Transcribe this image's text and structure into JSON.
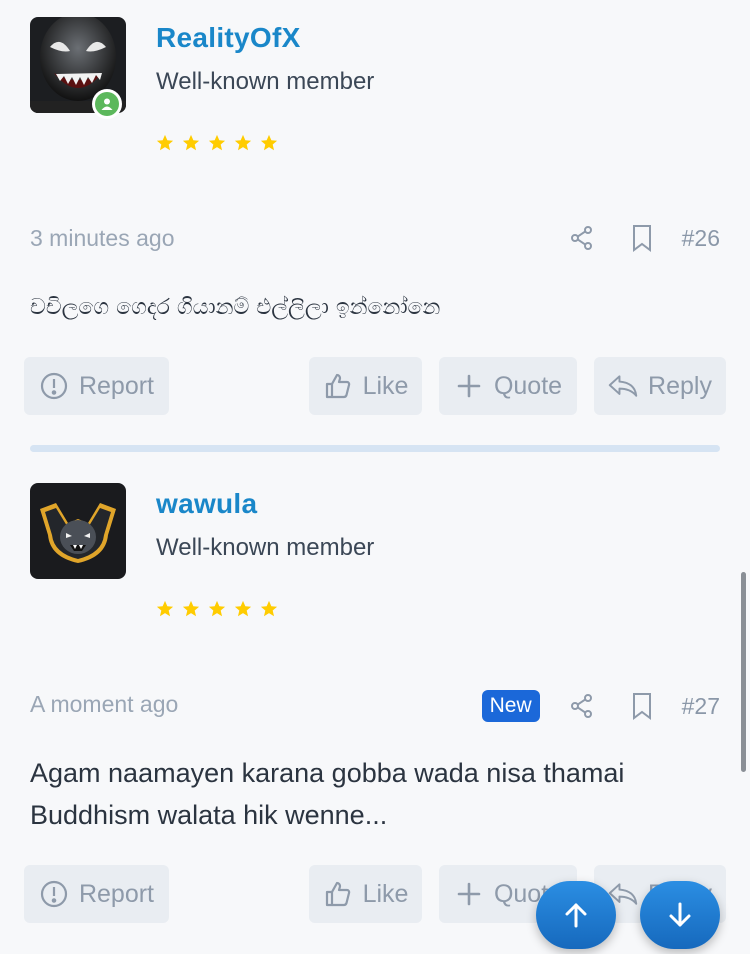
{
  "posts": [
    {
      "username": "RealityOfX",
      "user_title": "Well-known member",
      "stars": 5,
      "time": "3 minutes ago",
      "is_new": false,
      "number": "#26",
      "body": "චචිලගෙ ගෙදර ගියානම් එල්ලිලා ඉන්නෝනෙ",
      "actions": {
        "report": "Report",
        "like": "Like",
        "quote": "Quote",
        "reply": "Reply"
      }
    },
    {
      "username": "wawula",
      "user_title": "Well-known member",
      "stars": 5,
      "time": "A moment ago",
      "is_new": true,
      "new_label": "New",
      "number": "#27",
      "body": "Agam naamayen karana gobba wada nisa thamai Buddhism walata hik wenne...",
      "actions": {
        "report": "Report",
        "like": "Like",
        "quote": "Quote",
        "reply": "Reply"
      }
    }
  ],
  "colors": {
    "accent": "#1a87c9",
    "star": "#ffcc00",
    "new_badge": "#1b68d9",
    "online": "#5cb85c"
  },
  "icons": [
    "share-icon",
    "bookmark-icon",
    "report-icon",
    "like-icon",
    "quote-icon",
    "reply-icon",
    "arrow-up-icon",
    "arrow-down-icon",
    "online-user-icon"
  ]
}
